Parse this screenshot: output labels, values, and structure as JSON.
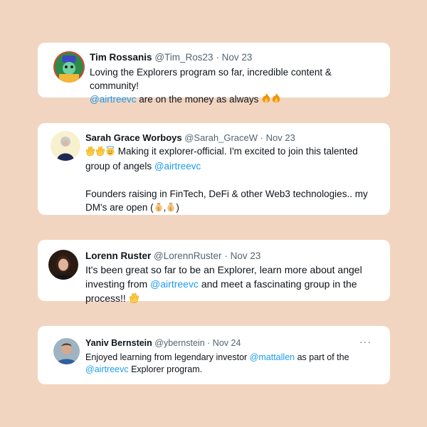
{
  "colors": {
    "background": "#f2d5c0",
    "card": "#ffffff",
    "mention": "#1d9bf0",
    "muted": "#536471"
  },
  "tweets": [
    {
      "name": "Tim Rossanis",
      "handle": "@Tim_Ros23",
      "separator": "·",
      "date": "Nov 23",
      "text_1": "Loving the Explorers program so far, incredible content & community!",
      "mention_1": "@airtreevc",
      "text_2": " are on the money as always ",
      "emoji": "fire-emoji x2"
    },
    {
      "name": "Sarah Grace Worboys",
      "handle": "@Sarah_GraceW",
      "separator": "·",
      "date": "Nov 23",
      "text_1": " Making it explorer-official. I'm excited to join this talented group of angels ",
      "mention_1": "@airtreevc",
      "text_2": "Founders raising in FinTech, DeFi & other Web3 technologies.. my DM's are open (",
      "text_3": ",",
      "text_4": ")",
      "emoji": "clap-emoji x2, smiling-face-with-halo-emoji, money-bag-emoji x2"
    },
    {
      "name": "Lorenn Ruster",
      "handle": "@LorennRuster",
      "separator": "·",
      "date": "Nov 23",
      "text_1": "It's been great so far to be an Explorer, learn more about angel investing from ",
      "mention_1": "@airtreevc",
      "text_2": " and meet a fascinating group in the process!! ",
      "emoji": "clap-emoji"
    },
    {
      "name": "Yaniv Bernstein",
      "handle": "@ybernstein",
      "separator": "·",
      "date": "Nov 24",
      "text_1": "Enjoyed learning from legendary investor ",
      "mention_1": "@mattallen",
      "text_2": " as part of the ",
      "mention_2": "@airtreevc",
      "text_3": " Explorer program.",
      "more": "···"
    }
  ]
}
